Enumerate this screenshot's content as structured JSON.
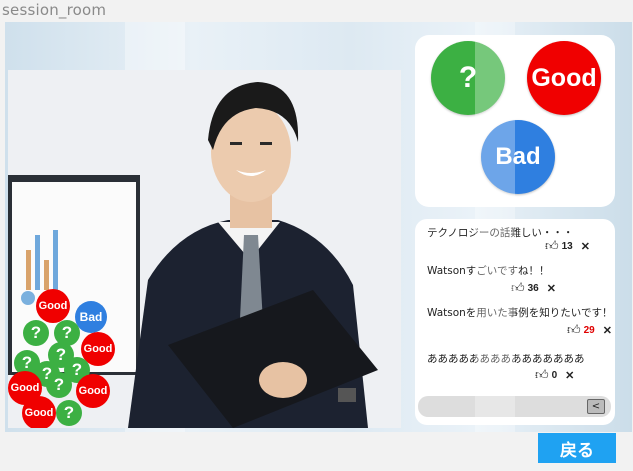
{
  "window": {
    "title": "session_room"
  },
  "reactions": {
    "question": "?",
    "good": "Good",
    "bad": "Bad"
  },
  "chat": {
    "messages": [
      {
        "text": "テクノロジーの話難しい・・・",
        "likes": "13",
        "delete": "✕",
        "highlight": false
      },
      {
        "text": "Watsonすごいですね！！",
        "likes": "36",
        "delete": "✕",
        "highlight": false
      },
      {
        "text": "Watsonを用いた事例を知りたいです！",
        "likes": "29",
        "delete": "✕",
        "highlight": true
      },
      {
        "text": "あああああああああああああああ",
        "likes": "0",
        "delete": "✕",
        "highlight": false
      }
    ],
    "input_value": "",
    "send_label": "<"
  },
  "back_label": "戻る",
  "floating_reactions": {
    "good": "Good",
    "bad": "Bad",
    "question": "?"
  },
  "colors": {
    "question": "#3cb043",
    "good": "#f00000",
    "bad": "#2f7fe0",
    "back": "#1fa2f2",
    "like_highlight": "#e00000"
  }
}
